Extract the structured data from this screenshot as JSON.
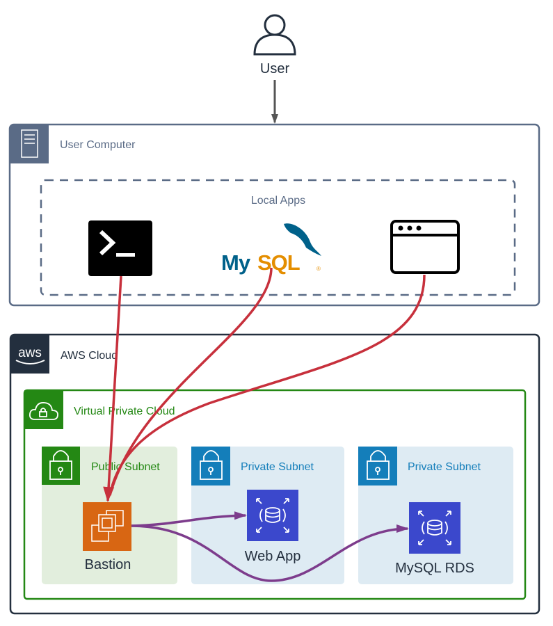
{
  "user": {
    "label": "User",
    "icon": "user-icon"
  },
  "user_computer": {
    "label": "User Computer",
    "icon": "server-icon",
    "color": "#5a6b86"
  },
  "local_apps": {
    "label": "Local Apps",
    "apps": [
      {
        "name": "terminal",
        "icon": "terminal-icon"
      },
      {
        "name": "mysql",
        "icon": "mysql-logo",
        "logo_text": "MySQL"
      },
      {
        "name": "browser",
        "icon": "browser-window-icon"
      }
    ]
  },
  "aws_cloud": {
    "label": "AWS Cloud",
    "icon": "aws-logo",
    "logo_text": "aws",
    "color": "#232f3e"
  },
  "vpc": {
    "label": "Virtual Private Cloud",
    "icon": "cloud-lock-icon",
    "color": "#248814"
  },
  "subnets": [
    {
      "label": "Public Subnet",
      "icon": "lock-icon",
      "color": "#248814",
      "fill": "#e2eedd"
    },
    {
      "label": "Private Subnet",
      "icon": "lock-icon",
      "color": "#147eba",
      "fill": "#deebf3"
    },
    {
      "label": "Private Subnet",
      "icon": "lock-icon",
      "color": "#147eba",
      "fill": "#deebf3"
    }
  ],
  "nodes": {
    "bastion": {
      "label": "Bastion",
      "icon": "ec2-instance-icon",
      "color": "#d86613"
    },
    "web_app": {
      "label": "Web App",
      "icon": "rds-database-icon",
      "color": "#3b48cc"
    },
    "mysql_rds": {
      "label": "MySQL RDS",
      "icon": "rds-database-icon",
      "color": "#3b48cc"
    }
  },
  "connections": {
    "local_color": "#c7303c",
    "bastion_color": "#7d3c8c"
  }
}
